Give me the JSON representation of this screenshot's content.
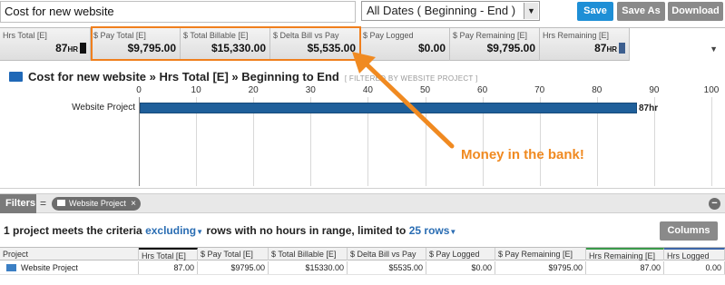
{
  "toolbar": {
    "report_name": "Cost for new website",
    "date_range": "All Dates ( Beginning - End )",
    "save_label": "Save",
    "save_as_label": "Save As",
    "download_label": "Download"
  },
  "metrics": [
    {
      "label": "Hrs Total [E]",
      "value": "87",
      "unit": "HR",
      "swatch": "#111111"
    },
    {
      "label": "$ Pay Total [E]",
      "value": "$9,795.00",
      "unit": "",
      "swatch": ""
    },
    {
      "label": "$ Total Billable [E]",
      "value": "$15,330.00",
      "unit": "",
      "swatch": ""
    },
    {
      "label": "$ Delta Bill vs Pay",
      "value": "$5,535.00",
      "unit": "",
      "swatch": ""
    },
    {
      "label": "$ Pay Logged",
      "value": "$0.00",
      "unit": "",
      "swatch": ""
    },
    {
      "label": "$ Pay Remaining [E]",
      "value": "$9,795.00",
      "unit": "",
      "swatch": ""
    },
    {
      "label": "Hrs Remaining [E]",
      "value": "87",
      "unit": "HR",
      "swatch": "#3d5f8f"
    }
  ],
  "chart": {
    "title": "Cost for new website » Hrs Total [E] » Beginning to End",
    "subtitle": "[ FILTERED BY WEBSITE PROJECT ]",
    "annotation": "Money in the bank!"
  },
  "chart_data": {
    "type": "bar",
    "orientation": "horizontal",
    "categories": [
      "Website Project"
    ],
    "values": [
      87
    ],
    "value_labels": [
      "87hr"
    ],
    "title": "Cost for new website » Hrs Total [E] » Beginning to End",
    "xlim": [
      0,
      100
    ],
    "ticks": [
      0,
      10,
      20,
      30,
      40,
      50,
      60,
      70,
      80,
      90,
      100
    ],
    "bar_color": "#1f5f9a",
    "grid": true
  },
  "filters": {
    "label": "Filters",
    "equals": "=",
    "pill": "Website Project",
    "pill_close": "×",
    "minus": "−"
  },
  "summary": {
    "prefix": "1 project meets the criteria",
    "excluding": "excluding",
    "middle": "rows with no hours in range, limited to",
    "limit": "25 rows"
  },
  "columns_button": "Columns",
  "table": {
    "headers": [
      "Project",
      "Hrs Total [E]",
      "$ Pay Total [E]",
      "$ Total Billable [E]",
      "$ Delta Bill vs Pay",
      "$ Pay Logged",
      "$ Pay Remaining [E]",
      "Hrs Remaining [E]",
      "Hrs Logged"
    ],
    "rows": [
      [
        "Website Project",
        "87.00",
        "$9795.00",
        "$15330.00",
        "$5535.00",
        "$0.00",
        "$9795.00",
        "87.00",
        "0.00"
      ]
    ]
  },
  "colors": {
    "accent": "#1e8fd6",
    "annotation": "#f08a21",
    "bar": "#1f5f9a"
  }
}
